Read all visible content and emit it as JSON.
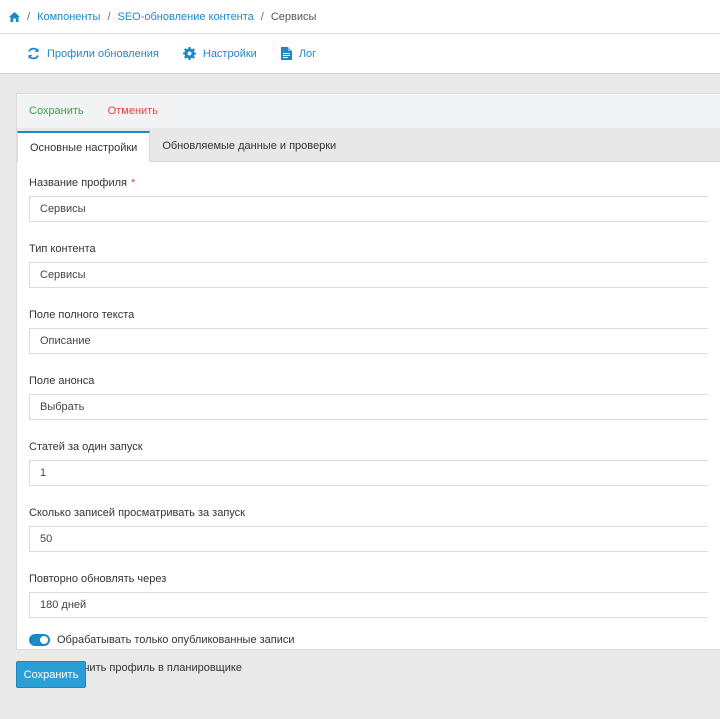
{
  "breadcrumb": {
    "items": [
      "Компоненты",
      "SEO-обновление контента"
    ],
    "current": "Сервисы",
    "separator": "/"
  },
  "toolbar": {
    "profiles": "Профили обновления",
    "settings": "Настройки",
    "log": "Лог"
  },
  "actions": {
    "save": "Сохранить",
    "cancel": "Отменить"
  },
  "tabs": [
    {
      "label": "Основные настройки",
      "active": true
    },
    {
      "label": "Обновляемые данные и проверки",
      "active": false
    }
  ],
  "form": {
    "profile_name": {
      "label": "Название профиля",
      "required": "*",
      "value": "Сервисы"
    },
    "content_type": {
      "label": "Тип контента",
      "value": "Сервисы"
    },
    "fulltext_field": {
      "label": "Поле полного текста",
      "value": "Описание"
    },
    "intro_field": {
      "label": "Поле анонса",
      "value": "Выбрать"
    },
    "articles_per_run": {
      "label": "Статей за один запуск",
      "value": "1"
    },
    "records_per_run": {
      "label": "Сколько записей просматривать за запуск",
      "value": "50"
    },
    "reupdate_after": {
      "label": "Повторно обновлять через",
      "value": "180 дней"
    },
    "toggle_published": {
      "label": "Обрабатывать только опубликованные записи",
      "on": true
    },
    "toggle_scheduler": {
      "label": "Включить профиль в планировщике",
      "on": true
    }
  },
  "footer": {
    "save": "Сохранить"
  },
  "colors": {
    "accent": "#1e88c7",
    "save": "#3ca144",
    "cancel": "#e5463a",
    "button": "#2a9ed6"
  }
}
